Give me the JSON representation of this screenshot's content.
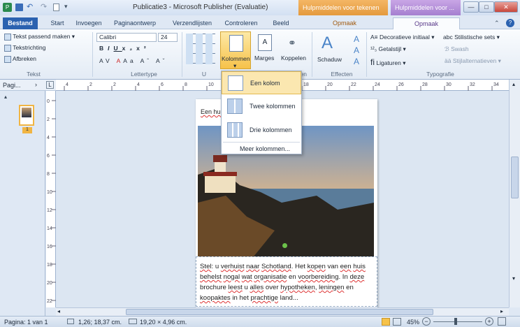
{
  "window": {
    "title": "Publicatie3 - Microsoft Publisher (Evaluatie)"
  },
  "context_tabs": [
    "Hulpmiddelen voor tekenen",
    "Hulpmiddelen voor ..."
  ],
  "tabs": [
    "Bestand",
    "Start",
    "Invoegen",
    "Paginaontwerp",
    "Verzendlijsten",
    "Controleren",
    "Beeld",
    "Opmaak",
    "Opmaak"
  ],
  "ribbon": {
    "tekst": {
      "items": [
        "Tekst passend maken",
        "Tekstrichting",
        "Afbreken"
      ],
      "label": "Tekst"
    },
    "lettertype": {
      "font": "Calibri",
      "size": "24",
      "label": "Lettertype"
    },
    "kolommen": "Kolommen",
    "marges": "Marges",
    "koppelen": "Koppelen",
    "elen_label": "elen",
    "schaduw": "Schaduw",
    "effecten_label": "Effecten",
    "typografie": {
      "items": [
        "Decoratieve initiaal",
        "Stilistische sets",
        "Getalstijl",
        "Swash",
        "Ligaturen",
        "Stijlalternatieven"
      ],
      "label": "Typografie"
    },
    "u_label": "U"
  },
  "dropdown": {
    "items": [
      "Een kolom",
      "Twee kolommen",
      "Drie kolommen"
    ],
    "more": "Meer kolommen..."
  },
  "pages_panel": {
    "header": "Pagi...",
    "page_number": "1"
  },
  "document": {
    "heading_fragment": "Een hui",
    "body_parts": [
      "Stel",
      ": u ",
      "verhuist",
      " ",
      "naar",
      " ",
      "Schotland",
      ". Het ",
      "kopen",
      " van ",
      "een",
      " ",
      "huis",
      " ",
      "behelst",
      " ",
      "nogal",
      " ",
      "wat",
      " ",
      "organisatie",
      " en ",
      "voorbereiding",
      ". In ",
      "deze",
      " brochure ",
      "leest",
      " u ",
      "alles",
      " over ",
      "hypotheken",
      ", ",
      "leningen",
      " en ",
      "koopaktes",
      " in het ",
      "prachtige",
      " land..."
    ]
  },
  "ruler": {
    "h_ticks": [
      "4",
      "2",
      "2",
      "4",
      "6",
      "8",
      "10",
      "12",
      "14",
      "16",
      "18",
      "20",
      "22",
      "24",
      "26",
      "28",
      "30",
      "32",
      "34"
    ],
    "v_ticks": [
      "0",
      "2",
      "4",
      "6",
      "8",
      "10",
      "12",
      "14",
      "16",
      "18",
      "20",
      "22"
    ]
  },
  "status": {
    "page": "Pagina: 1 van 1",
    "position": "1,26; 18,37 cm.",
    "size": "19,20 × 4,96 cm.",
    "zoom": "45%"
  }
}
